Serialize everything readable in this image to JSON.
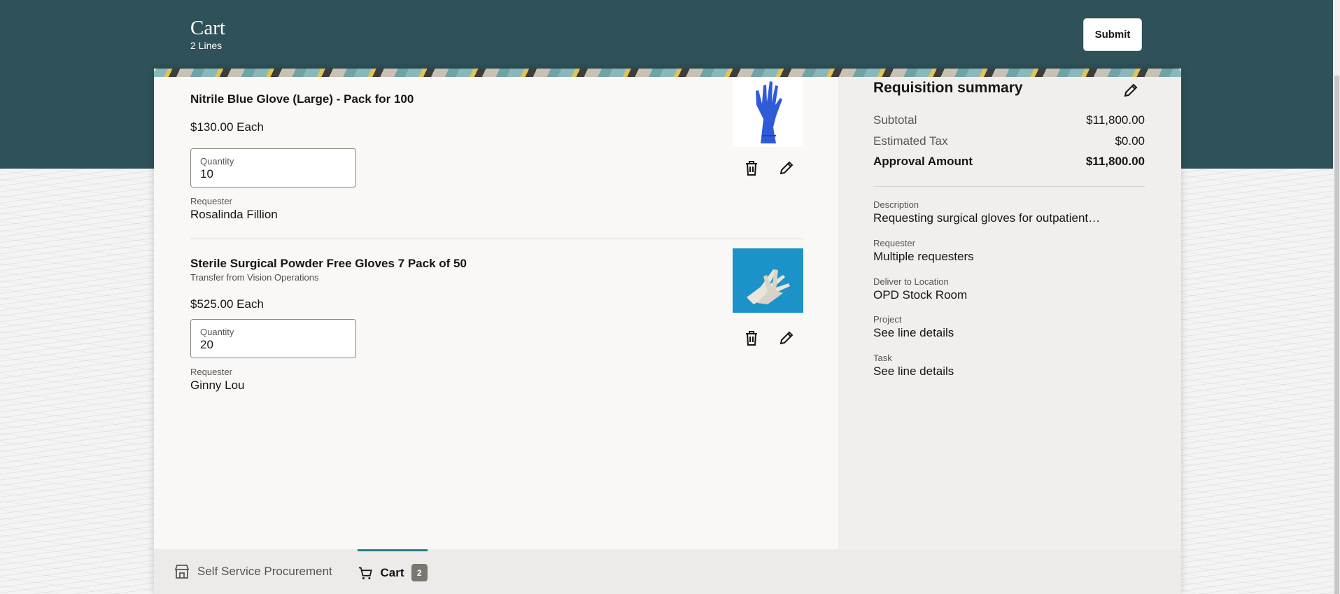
{
  "header": {
    "title": "Cart",
    "subtitle": "2 Lines",
    "submit_label": "Submit"
  },
  "lines": [
    {
      "name": "Nitrile Blue Glove (Large) - Pack for 100",
      "source": "",
      "price": "$130.00 Each",
      "quantity_label": "Quantity",
      "quantity": "10",
      "requester_label": "Requester",
      "requester": "Rosalinda Fillion",
      "image_icon": "blue-glove-image"
    },
    {
      "name": "Sterile Surgical Powder Free Gloves 7 Pack of 50",
      "source": "Transfer from Vision Operations",
      "price": "$525.00 Each",
      "quantity_label": "Quantity",
      "quantity": "20",
      "requester_label": "Requester",
      "requester": "Ginny Lou",
      "image_icon": "surgical-gloves-image"
    }
  ],
  "summary": {
    "title": "Requisition summary",
    "subtotal_label": "Subtotal",
    "subtotal": "$11,800.00",
    "tax_label": "Estimated Tax",
    "tax": "$0.00",
    "approval_label": "Approval Amount",
    "approval": "$11,800.00",
    "description_label": "Description",
    "description": "Requesting surgical gloves for outpatient…",
    "requester_label": "Requester",
    "requester": "Multiple requesters",
    "location_label": "Deliver to Location",
    "location": "OPD Stock Room",
    "project_label": "Project",
    "project": "See line details",
    "task_label": "Task",
    "task": "See line details"
  },
  "nav": {
    "procurement_label": "Self Service Procurement",
    "cart_label": "Cart",
    "cart_count": "2"
  },
  "colors": {
    "header": "#2f5159",
    "accent": "#2a7c8b",
    "badge": "#7a7670"
  }
}
